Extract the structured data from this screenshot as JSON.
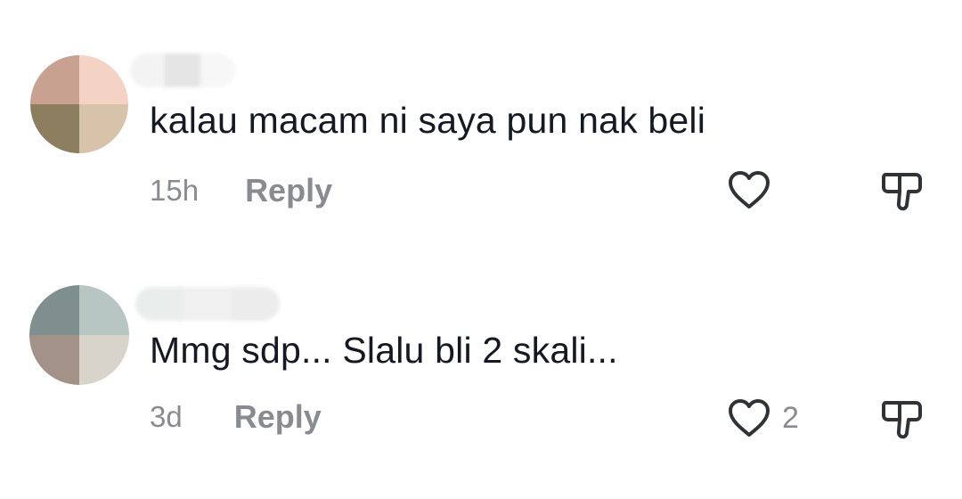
{
  "comments": [
    {
      "text": "kalau macam ni saya pun nak beli",
      "timestamp": "15h",
      "reply_label": "Reply",
      "like_count": "",
      "avatar_colors": [
        "#c9a191",
        "#f4d3c4",
        "#8e7e60",
        "#d6c3a9"
      ],
      "username_blur_colors": [
        "#f3f3f3",
        "#e5e5e5",
        "#f7f7f7"
      ],
      "like_icon": "heart-outline-icon",
      "dislike_icon": "thumbs-down-icon"
    },
    {
      "text": "Mmg sdp... Slalu bli 2 skali...",
      "timestamp": "3d",
      "reply_label": "Reply",
      "like_count": "2",
      "avatar_colors": [
        "#7f8f8d",
        "#b7c6c2",
        "#a39287",
        "#d8d4cc"
      ],
      "username_blur_colors": [
        "#e9eeec",
        "#f0f0f0",
        "#ececec"
      ],
      "like_icon": "heart-outline-icon",
      "dislike_icon": "thumbs-down-icon"
    }
  ],
  "colors": {
    "text_primary": "#161823",
    "text_secondary": "#8a8b91",
    "icon": "#303236",
    "background": "#ffffff"
  }
}
